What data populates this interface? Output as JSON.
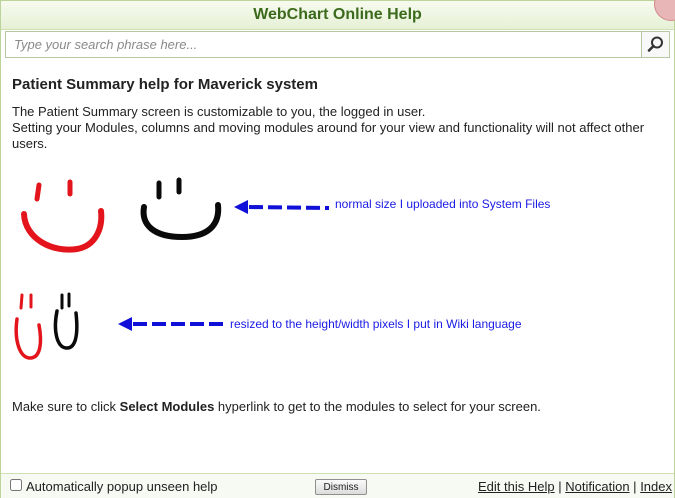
{
  "window": {
    "title": "WebChart Online Help"
  },
  "search": {
    "placeholder": "Type your search phrase here...",
    "button_icon": "search-icon"
  },
  "content": {
    "heading": "Patient Summary help for Maverick system",
    "paragraph_line1": "The Patient Summary screen is customizable to you, the logged in user.",
    "paragraph_line2": "Setting your Modules, columns and moving modules around for your view and functionality will not affect other",
    "paragraph_line3": "users.",
    "note_normal": "normal size I uploaded into System Files",
    "note_resized": "resized to the height/width pixels I put in Wiki language",
    "instruction_prefix": "Make sure to click ",
    "instruction_bold": "Select Modules",
    "instruction_suffix": " hyperlink to get to the modules to select for your screen.",
    "colors": {
      "red_smiley": "#e3141b",
      "black_smiley": "#0a0a0a",
      "arrow": "#1010d8"
    }
  },
  "footer": {
    "checkbox_label": "Automatically popup unseen help",
    "checkbox_checked": false,
    "dismiss_label": "Dismiss",
    "link_edit": "Edit this Help",
    "link_notification": "Notification",
    "link_index": "Index",
    "separator": "|"
  }
}
